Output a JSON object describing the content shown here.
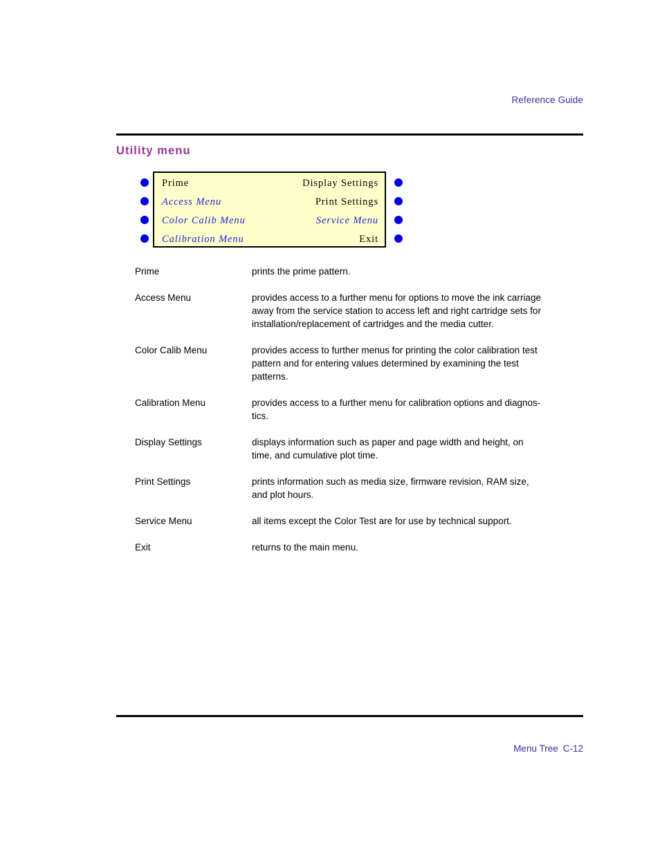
{
  "header": {
    "guide_label": "Reference Guide"
  },
  "section": {
    "title": "Utility menu"
  },
  "menu_diagram": {
    "box_background": "#ffffcc",
    "box_border": "#000000",
    "dot_color": "#0000dd",
    "link_color": "#2222cc",
    "rows": [
      {
        "left_label": "Prime",
        "left_style": "plain",
        "right_label": "Display Settings",
        "right_style": "plain"
      },
      {
        "left_label": "Access Menu",
        "left_style": "link",
        "right_label": "Print Settings",
        "right_style": "plain"
      },
      {
        "left_label": "Color Calib Menu",
        "left_style": "link",
        "right_label": "Service Menu",
        "right_style": "link"
      },
      {
        "left_label": "Calibration Menu",
        "left_style": "link",
        "right_label": "Exit",
        "right_style": "plain"
      }
    ],
    "left_dots": [
      "dot",
      "dot",
      "dot",
      "dot"
    ],
    "right_dots": [
      "dot",
      "dot",
      "dot",
      "dot"
    ]
  },
  "descriptions": [
    {
      "term": "Prime",
      "lines": [
        "prints the prime pattern."
      ]
    },
    {
      "term": "Access Menu",
      "lines": [
        "provides access to a further menu for options to move the ink carriage",
        "away from the service station to access left and right cartridge sets for",
        "installation/replacement of cartridges and the media cutter."
      ]
    },
    {
      "term": "Color Calib Menu",
      "lines": [
        "provides access to further menus for printing the color calibration test",
        "pattern and for entering values determined by examining the test",
        "patterns."
      ]
    },
    {
      "term": "Calibration Menu",
      "lines": [
        "provides access to a further menu for calibration options and diagnos-",
        "tics."
      ]
    },
    {
      "term": "Display Settings",
      "lines": [
        "displays information such as paper and page width and height, on",
        "time, and cumulative plot time."
      ]
    },
    {
      "term": "Print Settings",
      "lines": [
        "prints information such as media size, firmware revision, RAM size,",
        "and plot hours."
      ]
    },
    {
      "term": "Service Menu",
      "lines": [
        "all items except the Color Test are for use by technical support."
      ]
    },
    {
      "term": "Exit",
      "lines": [
        "returns to the main menu."
      ]
    }
  ],
  "footer": {
    "section_name": "Menu Tree",
    "page_number": "C-12"
  },
  "colors": {
    "heading_purple": "#993399",
    "running_head_blue": "#333399",
    "rule_black": "#000000"
  }
}
